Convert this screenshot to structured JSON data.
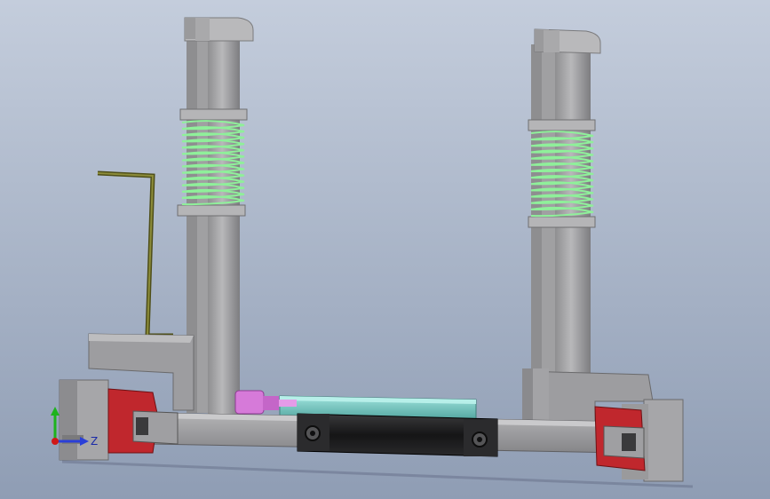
{
  "viewport": {
    "background_top": "#c4cddc",
    "background_bottom": "#8f9db4"
  },
  "model": {
    "colors": {
      "metal": "#a9a9ab",
      "metal_light": "#c9c9cb",
      "metal_dark": "#6e6e70",
      "spring": "#8ff09a",
      "red_block": "#c0272d",
      "black_bushing": "#1c1c1e",
      "cyan_rod": "#7ecdc7",
      "pink_fitting": "#d67ad9",
      "handle": "#6b6b2a"
    }
  },
  "triad": {
    "z_label": "Z",
    "y_color": "#1db31d",
    "z_color": "#2a3fd8",
    "x_color": "#d01818"
  }
}
